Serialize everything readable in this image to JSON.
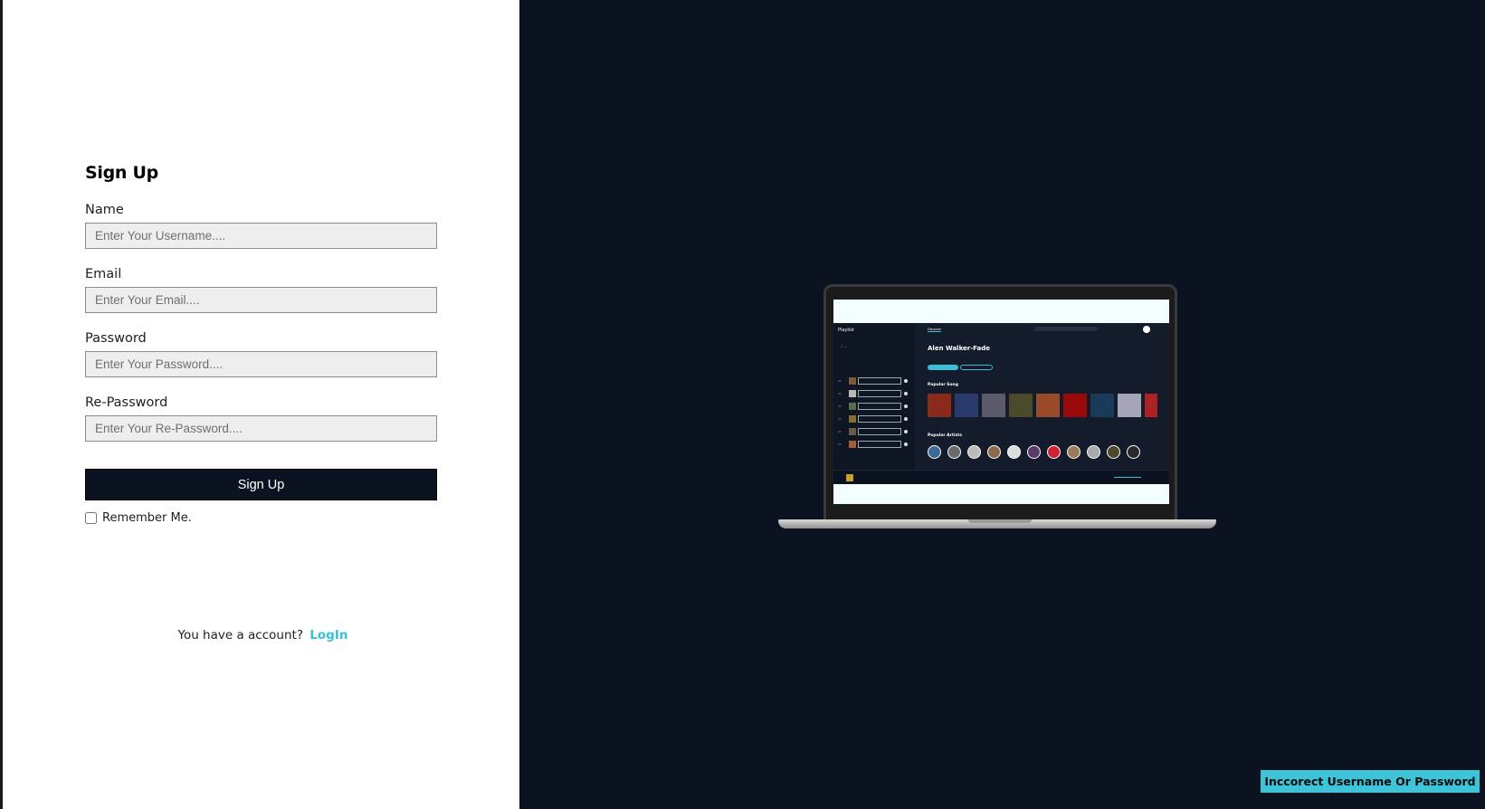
{
  "signup": {
    "title": "Sign Up",
    "fields": [
      {
        "label": "Name",
        "placeholder": "Enter Your Username...."
      },
      {
        "label": "Email",
        "placeholder": "Enter Your Email...."
      },
      {
        "label": "Password",
        "placeholder": "Enter Your Password...."
      },
      {
        "label": "Re-Password",
        "placeholder": "Enter Your Re-Password...."
      }
    ],
    "submit_label": "Sign Up",
    "remember_label": "Remember Me.",
    "account_prompt": "You have a account?",
    "login_label": "LogIn"
  },
  "preview": {
    "app_title": "Playlist",
    "tab_discover": "Discover",
    "hero_title": "Alen Walker-Fade",
    "section_songs": "Popular Song",
    "section_artists": "Popular Artists"
  },
  "toast": {
    "message": "Inccorect Username Or Password"
  },
  "colors": {
    "accent": "#39c0d6",
    "dark_bg": "#0c1320",
    "toast_bg": "#3ec4d9"
  }
}
